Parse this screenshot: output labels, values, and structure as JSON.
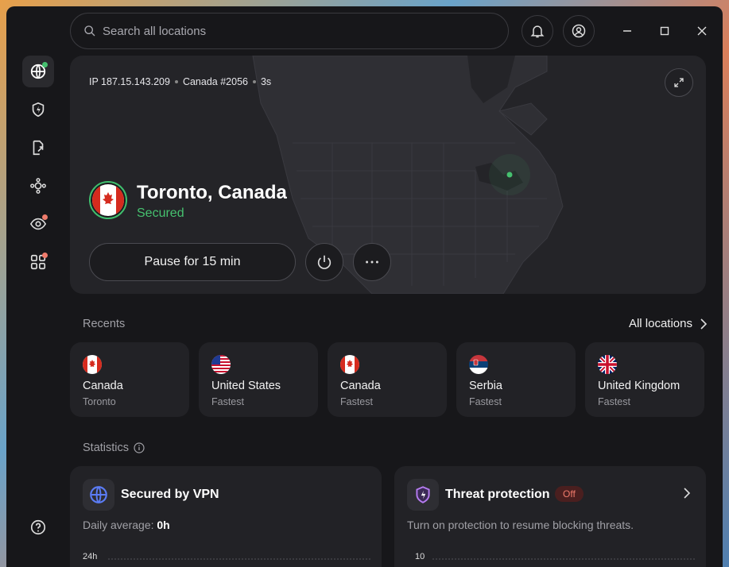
{
  "search": {
    "placeholder": "Search all locations"
  },
  "connection": {
    "ip": "IP 187.15.143.209",
    "server": "Canada #2056",
    "duration": "3s",
    "location": "Toronto, Canada",
    "status": "Secured"
  },
  "actions": {
    "pause_label": "Pause for 15 min"
  },
  "recents": {
    "label": "Recents",
    "all_locations": "All locations",
    "items": [
      {
        "country": "Canada",
        "sub": "Toronto",
        "flag": "canada-flag"
      },
      {
        "country": "United States",
        "sub": "Fastest",
        "flag": "usa-flag"
      },
      {
        "country": "Canada",
        "sub": "Fastest",
        "flag": "canada-flag"
      },
      {
        "country": "Serbia",
        "sub": "Fastest",
        "flag": "serbia-flag"
      },
      {
        "country": "United Kingdom",
        "sub": "Fastest",
        "flag": "uk-flag"
      }
    ]
  },
  "statistics": {
    "label": "Statistics",
    "vpn": {
      "title": "Secured by VPN",
      "desc_prefix": "Daily average: ",
      "desc_value": "0h",
      "axis_top": "24h"
    },
    "threat": {
      "title": "Threat protection",
      "badge": "Off",
      "desc": "Turn on protection to resume blocking threats.",
      "axis_top": "10"
    }
  },
  "colors": {
    "accent_green": "#46c16f",
    "background": "#17171a",
    "card": "#222226",
    "badge_off": "#ef7b6c",
    "notification_dot": "#ef7b6c"
  }
}
